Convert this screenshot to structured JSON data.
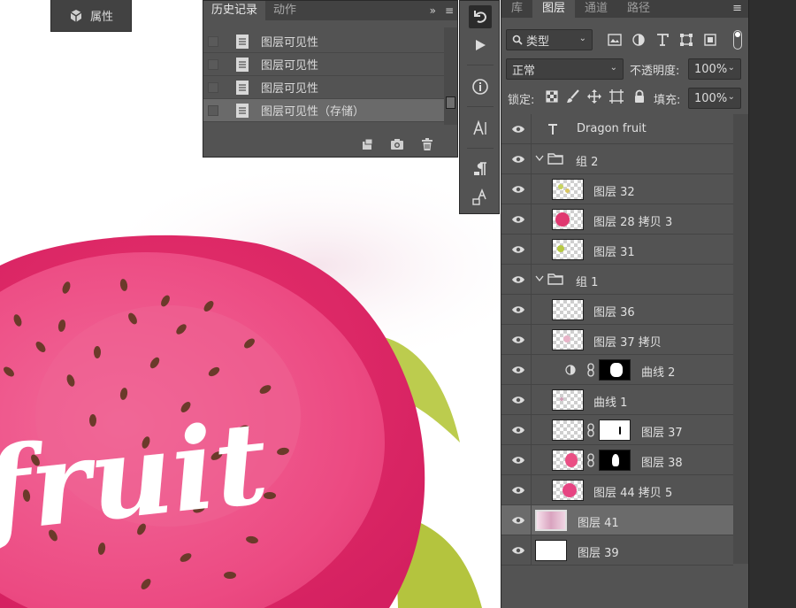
{
  "properties_tab": {
    "label": "属性",
    "icon": "cube-icon"
  },
  "history_panel": {
    "tabs": [
      {
        "label": "历史记录",
        "active": true
      },
      {
        "label": "动作",
        "active": false
      }
    ],
    "items": [
      {
        "label": "图层可见性",
        "selected": false
      },
      {
        "label": "图层可见性",
        "selected": false
      },
      {
        "label": "图层可见性",
        "selected": false
      },
      {
        "label": "图层可见性（存储）",
        "selected": true
      }
    ],
    "footer_icons": [
      "new-document-from-state-icon",
      "camera-snapshot-icon",
      "trash-icon"
    ]
  },
  "toolbar": {
    "icons": [
      "history-brush-icon",
      "play-actions-icon",
      "info-icon",
      "character-icon",
      "paragraph-icon",
      "glyphs-icon"
    ]
  },
  "layers_panel": {
    "tabs": [
      {
        "label": "库",
        "active": false
      },
      {
        "label": "图层",
        "active": true
      },
      {
        "label": "通道",
        "active": false
      },
      {
        "label": "路径",
        "active": false
      }
    ],
    "filter": {
      "label": "类型"
    },
    "blend_mode": "正常",
    "opacity": {
      "label": "不透明度:",
      "value": "100%"
    },
    "lock": {
      "label": "锁定:"
    },
    "fill": {
      "label": "填充:",
      "value": "100%"
    },
    "layers": [
      {
        "name": "Dragon fruit",
        "kind": "text"
      },
      {
        "name": "组 2",
        "kind": "group"
      },
      {
        "name": "图层 32",
        "kind": "pixel"
      },
      {
        "name": "图层 28 拷贝 3",
        "kind": "pixel"
      },
      {
        "name": "图层 31",
        "kind": "pixel"
      },
      {
        "name": "组 1",
        "kind": "group"
      },
      {
        "name": "图层 36",
        "kind": "pixel"
      },
      {
        "name": "图层 37 拷贝",
        "kind": "pixel"
      },
      {
        "name": "曲线 2",
        "kind": "adjustment"
      },
      {
        "name": "曲线 1",
        "kind": "pixel"
      },
      {
        "name": "图层 37",
        "kind": "masked"
      },
      {
        "name": "图层 38",
        "kind": "masked"
      },
      {
        "name": "图层 44 拷贝 5",
        "kind": "pixel"
      },
      {
        "name": "图层 41",
        "kind": "pixel",
        "selected": true
      },
      {
        "name": "图层 39",
        "kind": "background"
      }
    ]
  },
  "canvas": {
    "artwork_text": "fruit"
  },
  "colors": {
    "panel": "#535353",
    "panel_dark": "#424242",
    "selected_row": "#6b6b6b",
    "fruit_pink": "#ea3f79",
    "leaf_green": "#b6c83f",
    "seed_brown": "#6b3a2a"
  }
}
